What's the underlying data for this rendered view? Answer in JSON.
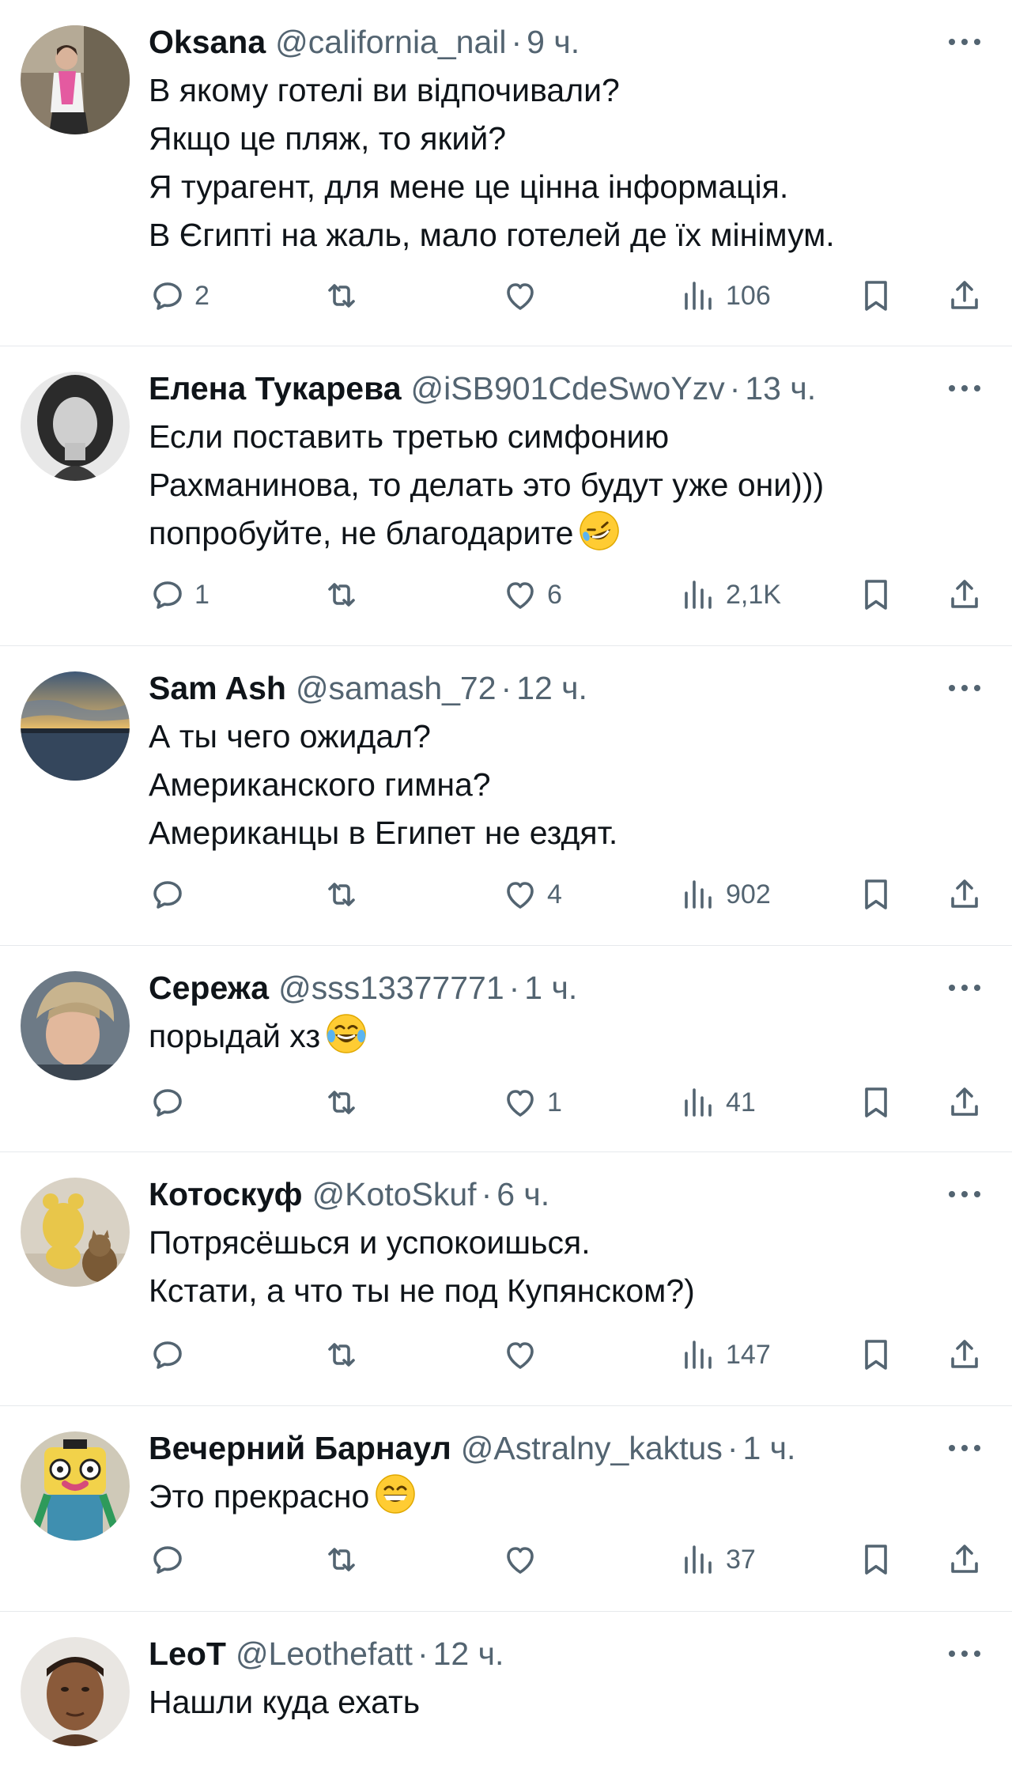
{
  "tweets": [
    {
      "name": "Oksana",
      "handle": "@california_nail",
      "sep": "·",
      "time": "9 ч.",
      "text": "В якому готелі ви відпочивали?\nЯкщо це пляж, то який?\nЯ турагент, для мене це цінна інформація.\nВ Єгипті на жаль, мало готелей де їх мінімум.",
      "emoji": "",
      "replies": "2",
      "retweets": "",
      "likes": "",
      "views": "106"
    },
    {
      "name": "Елена Тукарева",
      "handle": "@iSB901CdeSwoYzv",
      "sep": "·",
      "time": "13 ч.",
      "text": "Если поставить третью симфонию\nРахманинова, то делать это будут уже они)))\nпопробуйте, не благодарите",
      "emoji": "rofl",
      "replies": "1",
      "retweets": "",
      "likes": "6",
      "views": "2,1K"
    },
    {
      "name": "Sam Ash",
      "handle": "@samash_72",
      "sep": "·",
      "time": "12 ч.",
      "text": "А ты чего ожидал?\nАмериканского гимна?\nАмериканцы в Египет не ездят.",
      "emoji": "",
      "replies": "",
      "retweets": "",
      "likes": "4",
      "views": "902"
    },
    {
      "name": "Сережа",
      "handle": "@sss13377771",
      "sep": "·",
      "time": "1 ч.",
      "text": "порыдай хз",
      "emoji": "joy",
      "replies": "",
      "retweets": "",
      "likes": "1",
      "views": "41"
    },
    {
      "name": "Котоскуф",
      "handle": "@KotoSkuf",
      "sep": "·",
      "time": "6 ч.",
      "text": "Потрясёшься и успокоишься.\nКстати, а что ты не под Купянском?)",
      "emoji": "",
      "replies": "",
      "retweets": "",
      "likes": "",
      "views": "147"
    },
    {
      "name": "Вечерний Барнаул",
      "handle": "@Astralny_kaktus",
      "sep": "·",
      "time": "1 ч.",
      "text": "Это прекрасно",
      "emoji": "grin",
      "replies": "",
      "retweets": "",
      "likes": "",
      "views": "37"
    },
    {
      "name": "LeoT",
      "handle": "@Leothefatt",
      "sep": "·",
      "time": "12 ч.",
      "text": "Нашли куда ехать",
      "emoji": "",
      "replies": "",
      "retweets": "",
      "likes": "",
      "views": ""
    }
  ],
  "icons": {
    "reply": "reply-icon",
    "retweet": "retweet-icon",
    "like": "heart-icon",
    "views": "views-icon",
    "bookmark": "bookmark-icon",
    "share": "share-icon",
    "more": "more-icon"
  },
  "colors": {
    "text": "#0f1419",
    "secondary": "#536471",
    "divider": "#e6e9ec",
    "background": "#ffffff"
  }
}
